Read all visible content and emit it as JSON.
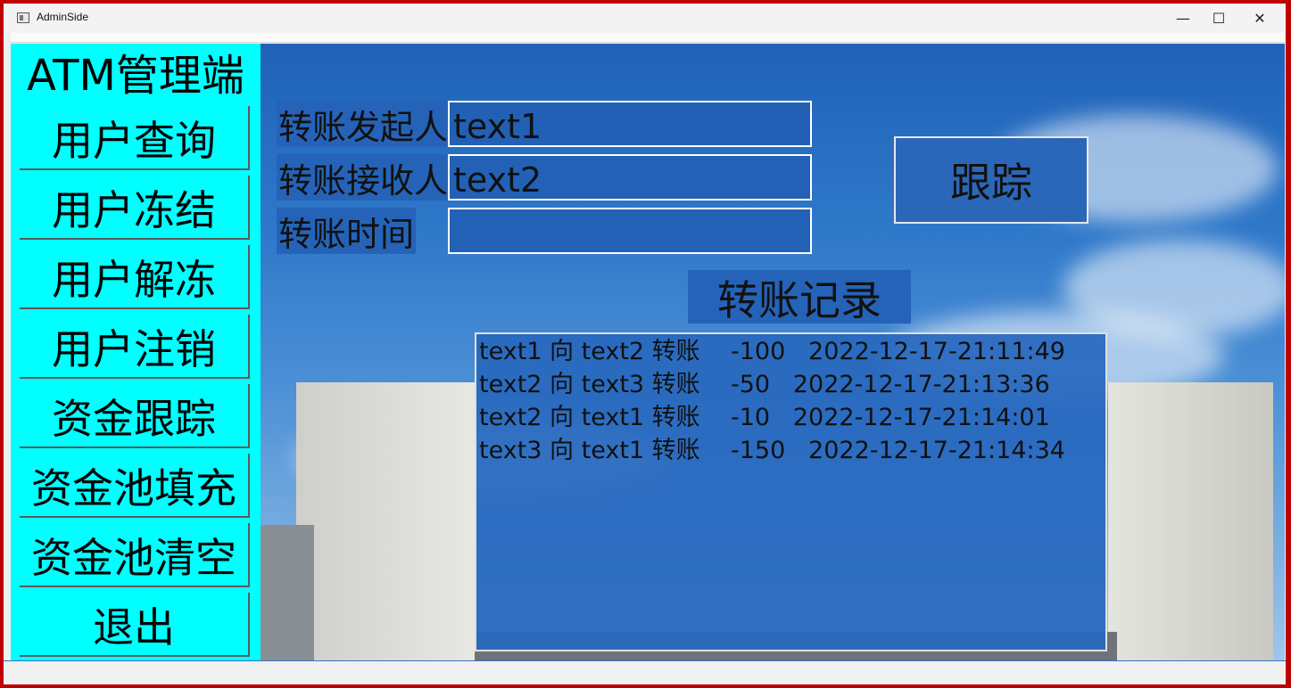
{
  "window": {
    "title": "AdminSide",
    "minimize": "—",
    "maximize": "☐",
    "close": "✕"
  },
  "sidebar": {
    "title": "ATM管理端",
    "items": [
      {
        "label": "用户查询"
      },
      {
        "label": "用户冻结"
      },
      {
        "label": "用户解冻"
      },
      {
        "label": "用户注销"
      },
      {
        "label": "资金跟踪"
      },
      {
        "label": "资金池填充"
      },
      {
        "label": "资金池清空"
      },
      {
        "label": "退出"
      }
    ]
  },
  "form": {
    "sender_label": "转账发起人",
    "sender_value": "text1",
    "receiver_label": "转账接收人",
    "receiver_value": "text2",
    "time_label": "转账时间",
    "time_value": "",
    "track_button": "跟踪"
  },
  "records": {
    "title": "转账记录",
    "rows": [
      "text1 向 text2 转账    -100   2022-12-17-21:11:49",
      "text2 向 text3 转账    -50   2022-12-17-21:13:36",
      "text2 向 text1 转账    -10   2022-12-17-21:14:01",
      "text3 向 text1 转账    -150   2022-12-17-21:14:34"
    ]
  },
  "colors": {
    "sidebar_bg": "#00ffff",
    "accent_blue": "#2563b8",
    "window_border": "#c00000"
  }
}
